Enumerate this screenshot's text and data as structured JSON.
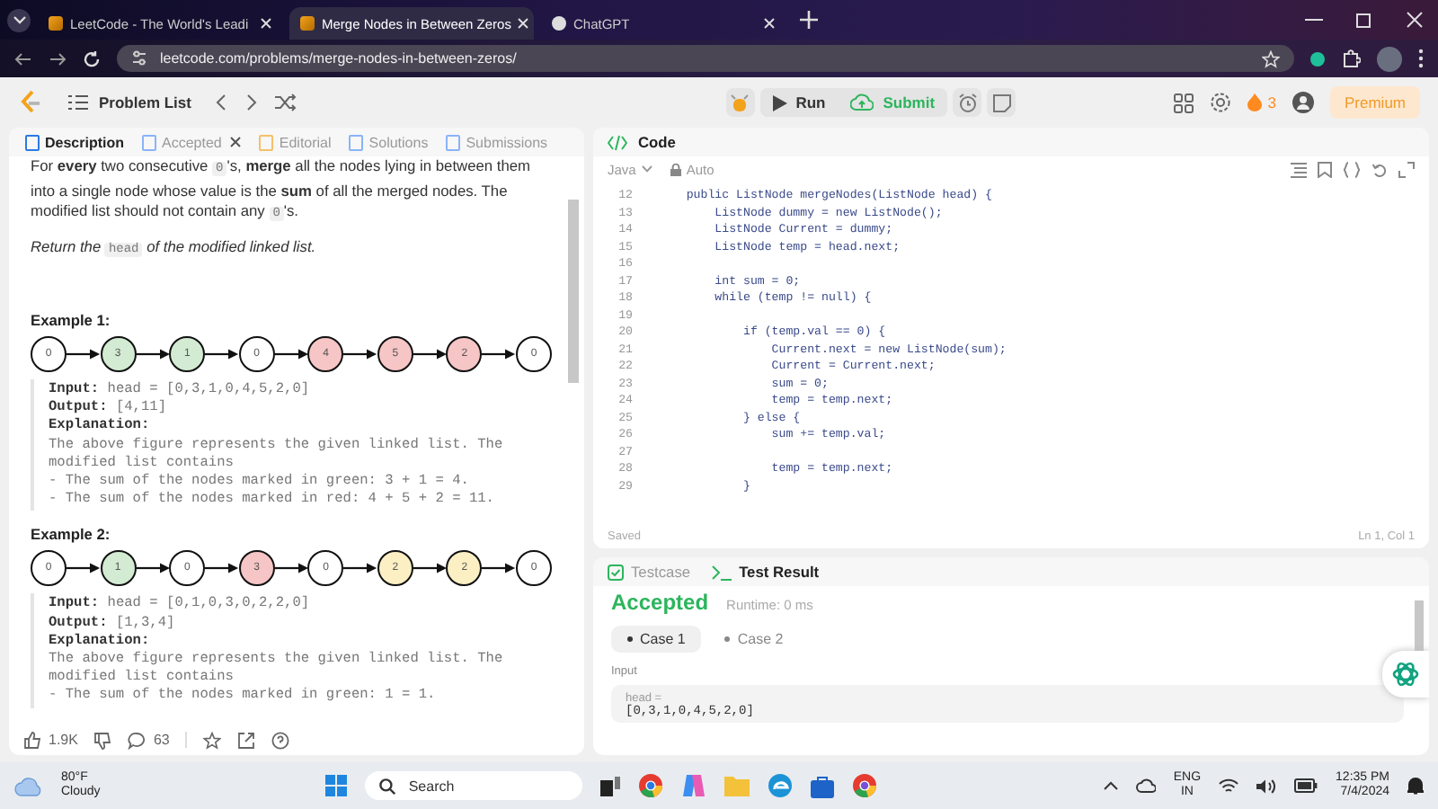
{
  "browser": {
    "tabs": [
      {
        "title": "LeetCode - The World's Leadi",
        "selected": false
      },
      {
        "title": "Merge Nodes in Between Zeros",
        "selected": true
      },
      {
        "title": "ChatGPT",
        "selected": false
      }
    ],
    "url": "leetcode.com/problems/merge-nodes-in-between-zeros/"
  },
  "navbar": {
    "problem_list": "Problem List",
    "run": "Run",
    "submit": "Submit",
    "streak": "3",
    "premium": "Premium"
  },
  "left_tabs": [
    {
      "label": "Description",
      "selected": true,
      "closable": false
    },
    {
      "label": "Accepted",
      "selected": false,
      "closable": true
    },
    {
      "label": "Editorial",
      "selected": false,
      "closable": false
    },
    {
      "label": "Solutions",
      "selected": false,
      "closable": false
    },
    {
      "label": "Submissions",
      "selected": false,
      "closable": false
    }
  ],
  "description": [
    {
      "kind": "text",
      "text": "For "
    },
    {
      "kind": "bold",
      "text": "every"
    },
    {
      "kind": "text",
      "text": " two consecutive "
    },
    {
      "kind": "code",
      "text": "0"
    },
    {
      "kind": "text",
      "text": "'s, "
    },
    {
      "kind": "bold",
      "text": "merge"
    },
    {
      "kind": "text",
      "text": " all the nodes lying in between them into a single node whose value is the "
    },
    {
      "kind": "bold",
      "text": "sum"
    },
    {
      "kind": "text",
      "text": " of all the merged nodes. The modified list should not contain any "
    },
    {
      "kind": "code",
      "text": "0"
    },
    {
      "kind": "text",
      "text": "'s."
    }
  ],
  "return_text": [
    {
      "kind": "italic",
      "text": "Return the "
    },
    {
      "kind": "code",
      "text": "head"
    },
    {
      "kind": "italic",
      "text": " of the modified linked list."
    }
  ],
  "examples": [
    {
      "title": "Example 1:",
      "nodes": [
        {
          "value": "0",
          "color": "#ffffff"
        },
        {
          "value": "3",
          "color": "#d3ebd2"
        },
        {
          "value": "1",
          "color": "#d3ebd2"
        },
        {
          "value": "0",
          "color": "#ffffff"
        },
        {
          "value": "4",
          "color": "#f6c5c5"
        },
        {
          "value": "5",
          "color": "#f6c5c5"
        },
        {
          "value": "2",
          "color": "#f6c5c5"
        },
        {
          "value": "0",
          "color": "#ffffff"
        }
      ],
      "input_label": "Input:",
      "input": "head = [0,3,1,0,4,5,2,0]",
      "output_label": "Output:",
      "output": "[4,11]",
      "explanation_label": "Explanation:",
      "explanation": [
        "The above figure represents the given linked list. The modified list contains",
        "- The sum of the nodes marked in green: 3 + 1 = 4.",
        "- The sum of the nodes marked in red: 4 + 5 + 2 = 11."
      ]
    },
    {
      "title": "Example 2:",
      "nodes": [
        {
          "value": "0",
          "color": "#ffffff"
        },
        {
          "value": "1",
          "color": "#d3ebd2"
        },
        {
          "value": "0",
          "color": "#ffffff"
        },
        {
          "value": "3",
          "color": "#f6c5c5"
        },
        {
          "value": "0",
          "color": "#ffffff"
        },
        {
          "value": "2",
          "color": "#fcefc3"
        },
        {
          "value": "2",
          "color": "#fcefc3"
        },
        {
          "value": "0",
          "color": "#ffffff"
        }
      ],
      "input_label": "Input:",
      "input": "head = [0,1,0,3,0,2,2,0]",
      "output_label": "Output:",
      "output": "[1,3,4]",
      "explanation_label": "Explanation:",
      "explanation": [
        "The above figure represents the given linked list. The modified list contains",
        "- The sum of the nodes marked in green: 1 = 1."
      ]
    }
  ],
  "stats": {
    "likes": "1.9K",
    "comments": "63"
  },
  "code_panel": {
    "title": "Code",
    "language": "Java",
    "mode": "Auto",
    "status": "Saved",
    "cursor": "Ln 1, Col 1",
    "lines": [
      {
        "n": "12",
        "code": "    public ListNode mergeNodes(ListNode head) {"
      },
      {
        "n": "13",
        "code": "        ListNode dummy = new ListNode();"
      },
      {
        "n": "14",
        "code": "        ListNode Current = dummy;"
      },
      {
        "n": "15",
        "code": "        ListNode temp = head.next;"
      },
      {
        "n": "16"
      },
      {
        "n": "17",
        "code": "        int sum = 0;"
      },
      {
        "n": "18",
        "code": "        while (temp != null) {"
      },
      {
        "n": "19"
      },
      {
        "n": "20",
        "code": "            if (temp.val == 0) {"
      },
      {
        "n": "21",
        "code": "                Current.next = new ListNode(sum);"
      },
      {
        "n": "22",
        "code": "                Current = Current.next;"
      },
      {
        "n": "23",
        "code": "                sum = 0;"
      },
      {
        "n": "24",
        "code": "                temp = temp.next;"
      },
      {
        "n": "25",
        "code": "            } else {"
      },
      {
        "n": "26",
        "code": "                sum += temp.val;"
      },
      {
        "n": "27"
      },
      {
        "n": "28",
        "code": "                temp = temp.next;"
      },
      {
        "n": "29",
        "code": "            }"
      }
    ]
  },
  "test_panel": {
    "tabs": [
      {
        "label": "Testcase",
        "selected": false
      },
      {
        "label": "Test Result",
        "selected": true
      }
    ],
    "verdict": "Accepted",
    "runtime": "Runtime: 0 ms",
    "cases": [
      {
        "label": "Case 1",
        "selected": true
      },
      {
        "label": "Case 2",
        "selected": false
      }
    ],
    "input_label": "Input",
    "param": "head =",
    "value": "[0,3,1,0,4,5,2,0]"
  },
  "taskbar": {
    "temperature": "80°F",
    "weather": "Cloudy",
    "search": "Search",
    "lang": "ENG",
    "region": "IN",
    "time": "12:35 PM",
    "date": "7/4/2024"
  }
}
